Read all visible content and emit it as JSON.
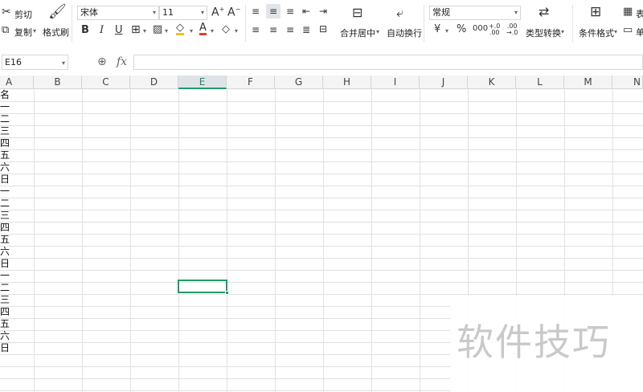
{
  "ribbon": {
    "clipboard": {
      "cut": "剪切",
      "copy": "复制",
      "format_painter": "格式刷"
    },
    "font": {
      "name": "宋体",
      "size": "11"
    },
    "alignment": {
      "merge_center": "合并居中",
      "wrap_text": "自动换行"
    },
    "number": {
      "format": "常规",
      "type_convert": "类型转换"
    },
    "styles": {
      "conditional_format": "条件格式",
      "table_style": "表",
      "cell_style": "单"
    }
  },
  "formula_bar": {
    "name_box": "E16",
    "fx": "fx",
    "value": ""
  },
  "sheet": {
    "columns": [
      "A",
      "B",
      "C",
      "D",
      "E",
      "F",
      "G",
      "H",
      "I",
      "J",
      "K",
      "L",
      "M",
      "N"
    ],
    "active_column": "E",
    "active_cell": "E16",
    "col_a_values": [
      "名",
      "一",
      "二",
      "三",
      "四",
      "五",
      "六",
      "日",
      "一",
      "二",
      "三",
      "四",
      "五",
      "六",
      "日",
      "一",
      "二",
      "三",
      "四",
      "五",
      "六",
      "日"
    ]
  },
  "watermark": "软件技巧"
}
